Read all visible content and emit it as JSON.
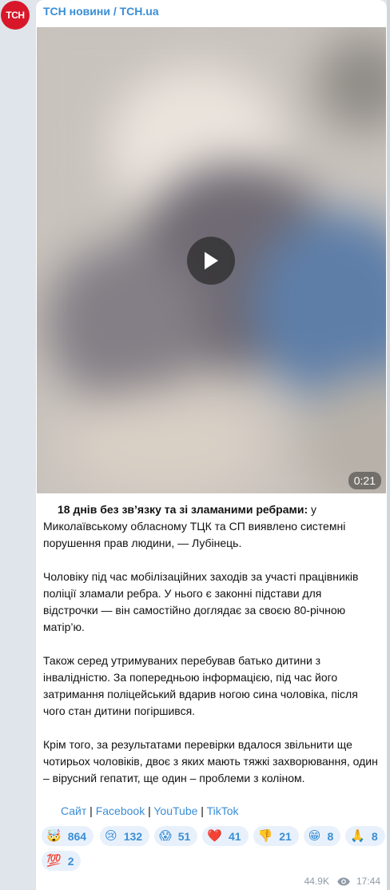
{
  "channel": {
    "name": "ТСН новини / TCH.ua",
    "avatar_text": "TCH",
    "avatar_color": "#d8182a",
    "name_color": "#3a8ed6"
  },
  "video": {
    "duration": "0:21",
    "play_icon": "play-icon"
  },
  "post": {
    "lead_bold": "18 днів без зв’язку та зі зламаними ребрами:",
    "lead_rest": " у Миколаївському обласному ТЦК та СП виявлено системні порушення прав людини, — Лубінець.",
    "p2": "Чоловіку під час мобілізаційних заходів за участі працівників поліції зламали ребра. У нього є законні підстави для відстрочки — він самостійно доглядає за своєю 80-річною матір’ю.",
    "p3": "Також серед утримуваних перебував батько дитини з інвалідністю. За попередньою інформацією, під час його затримання поліцейський вдарив ногою сина чоловіка, після чого стан дитини погіршився.",
    "p4": "Крім того, за результатами перевірки вдалося звільнити ще чотирьох чоловіків, двоє з яких мають тяжкі захворювання, один – вірусний гепатит, ще один – проблеми з коліном."
  },
  "links": {
    "site": "Сайт",
    "facebook": "Facebook",
    "youtube": "YouTube",
    "tiktok": "TikTok",
    "separator": " | "
  },
  "reactions": [
    {
      "emoji": "🤯",
      "count": "864"
    },
    {
      "emoji": "😢",
      "count": "132"
    },
    {
      "emoji": "😱",
      "count": "51"
    },
    {
      "emoji": "❤️",
      "count": "41"
    },
    {
      "emoji": "👎",
      "count": "21"
    },
    {
      "emoji": "😁",
      "count": "8"
    },
    {
      "emoji": "🙏",
      "count": "8"
    },
    {
      "emoji": "💯",
      "count": "2"
    }
  ],
  "meta": {
    "views": "44.9K",
    "time": "17:44",
    "views_icon": "eye-icon"
  }
}
